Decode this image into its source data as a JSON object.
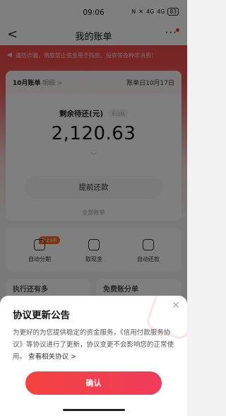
{
  "status_bar": {
    "time": "09:06",
    "signal": "4G",
    "signal2": "4G",
    "battery": "83"
  },
  "header": {
    "title": "我的账单",
    "more_label": "···"
  },
  "notice": {
    "text": "谨防诈骗，借款禁止资金用于购房、投资等各种非消费!"
  },
  "bill_card": {
    "month_label": "10月账单",
    "detail_link": "明细 >",
    "bill_day": "账单日10月17日",
    "remain_label": "剩余待还(元)",
    "tag": "未出账",
    "amount": "2,120.63",
    "early_repay_button": "提前还款",
    "all_bills_link": "全部账单"
  },
  "quick_actions": {
    "badge": "折上9折",
    "items": [
      {
        "label": "自动分期",
        "icon": "calendar-clock-icon"
      },
      {
        "label": "取现金",
        "icon": "cash-icon"
      },
      {
        "label": "自动还款",
        "icon": "auto-repay-icon"
      }
    ]
  },
  "lower_cards": [
    "执行还有多",
    "免费账分单"
  ],
  "dialog": {
    "title": "协议更新公告",
    "body": "为更好的为您提供稳定的资金服务，《信用付款服务协议》等协议进行了更新，协议变更不会影响您的正常使用。",
    "link": "查看相关协议 >",
    "confirm_button": "确认",
    "close_icon": "close-icon"
  },
  "colors": {
    "accent": "#ef4444",
    "header_red": "#ee4646"
  }
}
